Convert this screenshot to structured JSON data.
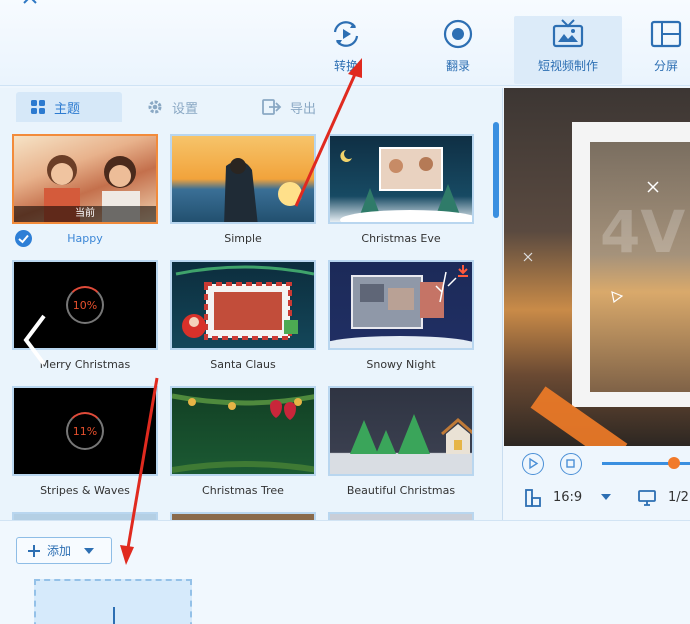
{
  "toolbar": {
    "items": [
      {
        "label": "转换",
        "icon": "convert-icon"
      },
      {
        "label": "翻录",
        "icon": "record-icon"
      },
      {
        "label": "短视频制作",
        "icon": "tv-icon",
        "active": true
      },
      {
        "label": "分屏",
        "icon": "split-screen-icon"
      }
    ]
  },
  "tabs": [
    {
      "label": "主题",
      "icon": "theme-grid-icon",
      "active": true
    },
    {
      "label": "设置",
      "icon": "gear-icon"
    },
    {
      "label": "导出",
      "icon": "export-icon"
    }
  ],
  "themes": [
    {
      "name": "Happy",
      "overlay": "当前",
      "selected": true
    },
    {
      "name": "Simple"
    },
    {
      "name": "Christmas Eve"
    },
    {
      "name": "Merry Christmas",
      "progress": "10%"
    },
    {
      "name": "Santa Claus"
    },
    {
      "name": "Snowy Night"
    },
    {
      "name": "Stripes & Waves",
      "progress": "11%"
    },
    {
      "name": "Christmas Tree"
    },
    {
      "name": "Beautiful Christmas"
    }
  ],
  "add_button": {
    "label": "添加"
  },
  "preview": {
    "watermark": "4V",
    "aspect_ratio": "16:9",
    "page_indicator": "1/2"
  },
  "colors": {
    "accent": "#2e7fd6",
    "selected_border": "#f28b3b",
    "annotation": "#e02a1f"
  }
}
